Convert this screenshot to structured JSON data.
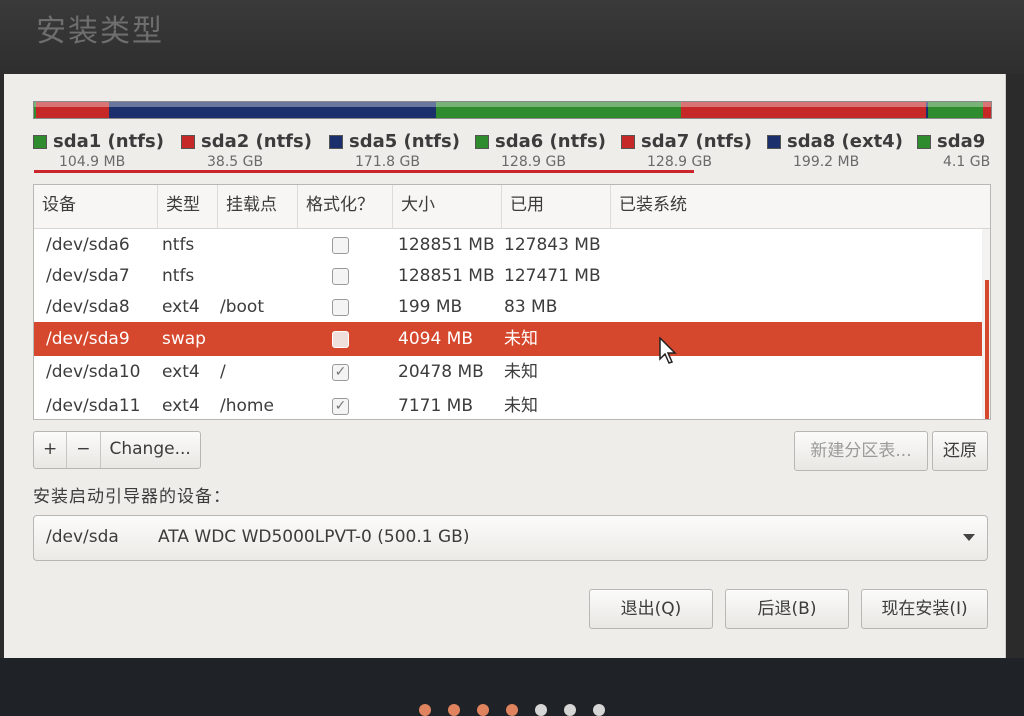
{
  "window": {
    "title": "安装类型"
  },
  "partition_bar": {
    "segments": [
      {
        "name": "sda1",
        "color": "#2e8b2e",
        "fraction": 0.0002
      },
      {
        "name": "sda2",
        "color": "#c62828",
        "fraction": 0.077
      },
      {
        "name": "sda5",
        "color": "#1a2f6b",
        "fraction": 0.343
      },
      {
        "name": "sda6",
        "color": "#2e8b2e",
        "fraction": 0.257
      },
      {
        "name": "sda7",
        "color": "#c62828",
        "fraction": 0.257
      },
      {
        "name": "sda8",
        "color": "#1a2f6b",
        "fraction": 0.0004
      },
      {
        "name": "sda9",
        "color": "#2e8b2e",
        "fraction": 0.058
      },
      {
        "name": "sda10",
        "color": "#c62828",
        "fraction": 0.008
      }
    ]
  },
  "legend": [
    {
      "name": "sda1 (ntfs)",
      "size": "104.9 MB",
      "color": "#2e8b2e"
    },
    {
      "name": "sda2 (ntfs)",
      "size": "38.5 GB",
      "color": "#c62828"
    },
    {
      "name": "sda5 (ntfs)",
      "size": "171.8 GB",
      "color": "#1a2f6b"
    },
    {
      "name": "sda6 (ntfs)",
      "size": "128.9 GB",
      "color": "#2e8b2e"
    },
    {
      "name": "sda7 (ntfs)",
      "size": "128.9 GB",
      "color": "#c62828"
    },
    {
      "name": "sda8 (ext4)",
      "size": "199.2 MB",
      "color": "#1a2f6b"
    },
    {
      "name": "sda9",
      "size": "4.1 GB",
      "color": "#2e8b2e"
    }
  ],
  "table": {
    "headers": [
      "设备",
      "类型",
      "挂载点",
      "格式化？",
      "大小",
      "已用",
      "已装系统"
    ],
    "rows": [
      {
        "device": "/dev/sda6",
        "type": "ntfs",
        "mount": "",
        "format": false,
        "size": "128851 MB",
        "used": "127843 MB",
        "system": "",
        "selected": false
      },
      {
        "device": "/dev/sda7",
        "type": "ntfs",
        "mount": "",
        "format": false,
        "size": "128851 MB",
        "used": "127471 MB",
        "system": "",
        "selected": false
      },
      {
        "device": "/dev/sda8",
        "type": "ext4",
        "mount": "/boot",
        "format": false,
        "size": "199 MB",
        "used": "83 MB",
        "system": "",
        "selected": false
      },
      {
        "device": "/dev/sda9",
        "type": "swap",
        "mount": "",
        "format": false,
        "size": "4094 MB",
        "used": "未知",
        "system": "",
        "selected": true
      },
      {
        "device": "/dev/sda10",
        "type": "ext4",
        "mount": "/",
        "format": true,
        "size": "20478 MB",
        "used": "未知",
        "system": "",
        "selected": false
      },
      {
        "device": "/dev/sda11",
        "type": "ext4",
        "mount": "/home",
        "format": true,
        "size": "7171 MB",
        "used": "未知",
        "system": "",
        "selected": false
      }
    ]
  },
  "toolbar": {
    "add_label": "+",
    "remove_label": "−",
    "change_label": "Change...",
    "new_table_label": "新建分区表...",
    "revert_label": "还原"
  },
  "bootloader": {
    "label": "安装启动引导器的设备：",
    "device": "/dev/sda",
    "model": "ATA WDC WD5000LPVT-0 (500.1 GB)"
  },
  "buttons": {
    "quit": "退出(Q)",
    "back": "后退(B)",
    "install": "现在安装(I)"
  },
  "progress_dots": {
    "total": 7,
    "active": 4
  }
}
